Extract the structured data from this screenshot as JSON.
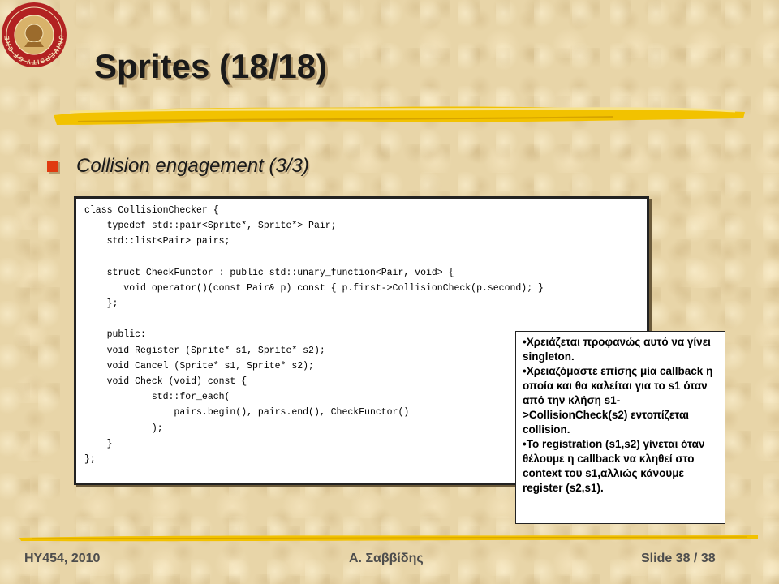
{
  "slide": {
    "logo": {
      "icon": "university-seal-icon",
      "ring_text": "UNIVERSITY OF CRETE",
      "color": "#b22222"
    },
    "title": "Sprites (18/18)",
    "bullet": "Collision engagement (3/3)",
    "code_lines": [
      "class CollisionChecker {",
      "    typedef std::pair<Sprite*, Sprite*> Pair;",
      "    std::list<Pair> pairs;",
      "",
      "    struct CheckFunctor : public std::unary_function<Pair, void> {",
      "       void operator()(const Pair& p) const { p.first->CollisionCheck(p.second); }",
      "    };",
      "",
      "    public:",
      "    void Register (Sprite* s1, Sprite* s2);",
      "    void Cancel (Sprite* s1, Sprite* s2);",
      "    void Check (void) const {",
      "            std::for_each(",
      "                pairs.begin(), pairs.end(), CheckFunctor()",
      "            );",
      "    }",
      "};"
    ],
    "notes": [
      "•Χρειάζεται προφανώς αυτό να γίνει singleton.",
      "•Χρειαζόμαστε επίσης μία callback η οποία και θα καλείται για το s1 όταν από την κλήση s1->CollisionCheck(s2) εντοπίζεται collision.",
      "•Το registration (s1,s2) γίνεται όταν θέλουμε η callback να κληθεί στο context του s1,αλλιώς κάνουμε register (s2,s1)."
    ],
    "footer": {
      "left": "HY454, 2010",
      "center": "Α. Σαββίδης",
      "right": "Slide 38 / 38"
    },
    "colors": {
      "bullet": "#e03a10",
      "brush": "#f2c200",
      "background": "#e8d5a8"
    }
  }
}
